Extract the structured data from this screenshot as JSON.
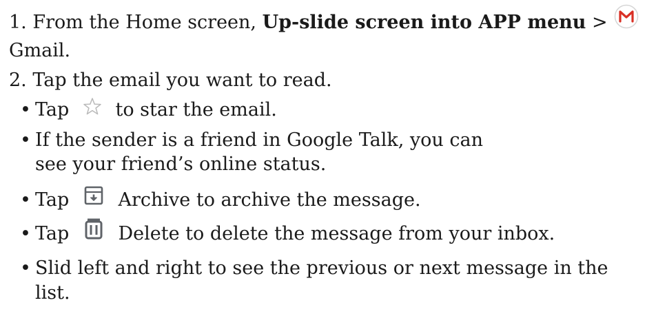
{
  "steps": {
    "step1": {
      "prefix": "1. From the Home screen, ",
      "bold": "Up-slide screen into APP menu",
      "suffix": " >",
      "continuation": "Gmail."
    },
    "step2": "2. Tap the email you want to read."
  },
  "bullets": {
    "dot": "•",
    "star": {
      "before": "Tap",
      "after": "to star the email.",
      "icon": "star-outline-icon"
    },
    "sender": {
      "line1": "If the sender is a friend in Google Talk, you can",
      "line2": "see your friend’s online status."
    },
    "archive": {
      "before": "Tap",
      "after": "Archive to archive the message.",
      "icon": "archive-icon"
    },
    "delete": {
      "before": "Tap",
      "after": "Delete to delete the message from your inbox.",
      "icon": "trash-icon"
    },
    "slide": {
      "line1": "Slid left and right to see the previous or next message in the",
      "line2": "list."
    }
  },
  "icons": {
    "gmail": "gmail-icon",
    "gmail_color": "#d93025",
    "icon_gray": "#5f6368",
    "star_gray": "#b9b9b9"
  }
}
